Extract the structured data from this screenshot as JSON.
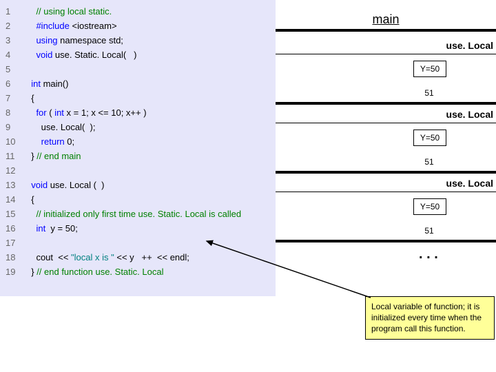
{
  "code_lines": [
    {
      "n": "1",
      "segments": [
        {
          "cls": "comment",
          "t": "    // using local static."
        }
      ]
    },
    {
      "n": "2",
      "segments": [
        {
          "cls": "pp",
          "t": "    #include "
        },
        {
          "cls": "",
          "t": "<iostream>"
        }
      ]
    },
    {
      "n": "3",
      "segments": [
        {
          "cls": "kw",
          "t": "    using"
        },
        {
          "cls": "",
          "t": " namespace std;"
        }
      ]
    },
    {
      "n": "4",
      "segments": [
        {
          "cls": "kw",
          "t": "    void"
        },
        {
          "cls": "",
          "t": " use. Static. Local(   )"
        }
      ]
    },
    {
      "n": "5",
      "segments": [
        {
          "cls": "",
          "t": " "
        }
      ]
    },
    {
      "n": "6",
      "segments": [
        {
          "cls": "kw",
          "t": "  int"
        },
        {
          "cls": "",
          "t": " main()"
        }
      ]
    },
    {
      "n": "7",
      "segments": [
        {
          "cls": "",
          "t": "  {"
        }
      ]
    },
    {
      "n": "8",
      "segments": [
        {
          "cls": "kw",
          "t": "    for"
        },
        {
          "cls": "",
          "t": " ( "
        },
        {
          "cls": "kw",
          "t": "int"
        },
        {
          "cls": "",
          "t": " x = "
        },
        {
          "cls": "num",
          "t": "1"
        },
        {
          "cls": "",
          "t": "; x <= "
        },
        {
          "cls": "num",
          "t": "10"
        },
        {
          "cls": "",
          "t": "; x++ )"
        }
      ]
    },
    {
      "n": "9",
      "segments": [
        {
          "cls": "",
          "t": "      use. Local(  );"
        }
      ]
    },
    {
      "n": "10",
      "segments": [
        {
          "cls": "kw",
          "t": "      return"
        },
        {
          "cls": "",
          "t": " "
        },
        {
          "cls": "num",
          "t": "0"
        },
        {
          "cls": "",
          "t": ";"
        }
      ]
    },
    {
      "n": "11",
      "segments": [
        {
          "cls": "",
          "t": "  } "
        },
        {
          "cls": "comment",
          "t": "// end main"
        }
      ]
    },
    {
      "n": "12",
      "segments": [
        {
          "cls": "",
          "t": " "
        }
      ]
    },
    {
      "n": "13",
      "segments": [
        {
          "cls": "kw",
          "t": "  void"
        },
        {
          "cls": "",
          "t": " use. Local (  )"
        }
      ]
    },
    {
      "n": "14",
      "segments": [
        {
          "cls": "",
          "t": "  {"
        }
      ]
    },
    {
      "n": "15",
      "segments": [
        {
          "cls": "comment",
          "t": "    // initialized only first time use. Static. Local is called"
        }
      ]
    },
    {
      "n": "16",
      "segments": [
        {
          "cls": "kw",
          "t": "    int"
        },
        {
          "cls": "",
          "t": "  y = "
        },
        {
          "cls": "num",
          "t": "50"
        },
        {
          "cls": "",
          "t": ";"
        }
      ]
    },
    {
      "n": "17",
      "segments": [
        {
          "cls": "",
          "t": " "
        }
      ]
    },
    {
      "n": "18",
      "segments": [
        {
          "cls": "",
          "t": "    cout  << "
        },
        {
          "cls": "str",
          "t": "\"local x is \""
        },
        {
          "cls": "",
          "t": " << y   ++  << endl;"
        }
      ]
    },
    {
      "n": "19",
      "segments": [
        {
          "cls": "",
          "t": "  } "
        },
        {
          "cls": "comment",
          "t": "// end function use. Static. Local"
        }
      ]
    }
  ],
  "diagram": {
    "main_label": "main",
    "use_local_label": "use. Local",
    "ybox_label": "Y=50",
    "val_after": "51",
    "dots": ". . .",
    "callout": "Local variable of function; it is initialized every time when the program call this function."
  }
}
